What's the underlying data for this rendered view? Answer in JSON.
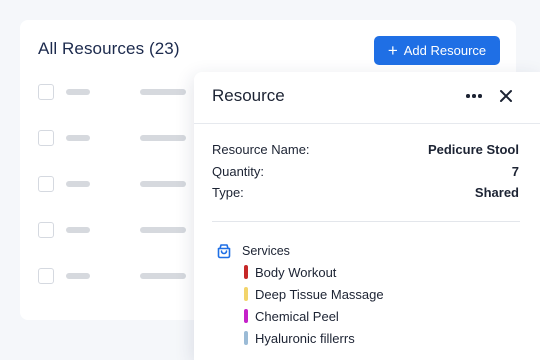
{
  "list": {
    "title": "All Resources (23)",
    "add_button": "Add Resource",
    "row_count": 5
  },
  "panel": {
    "title": "Resource",
    "fields": [
      {
        "label": "Resource Name:",
        "value": "Pedicure Stool"
      },
      {
        "label": "Quantity:",
        "value": "7"
      },
      {
        "label": "Type:",
        "value": "Shared"
      }
    ],
    "services_label": "Services",
    "services": [
      {
        "name": "Body Workout",
        "color": "#c62828"
      },
      {
        "name": "Deep Tissue Massage",
        "color": "#f2d46b"
      },
      {
        "name": "Chemical Peel",
        "color": "#c521c9"
      },
      {
        "name": "Hyaluronic fillerrs",
        "color": "#9bbbd6"
      }
    ]
  },
  "colors": {
    "accent": "#1f6fe5",
    "title_color": "#1c2a4d"
  },
  "icons": {
    "add": "plus-icon",
    "more": "more-horizontal-icon",
    "close": "close-icon",
    "services": "shopping-bag-icon"
  }
}
